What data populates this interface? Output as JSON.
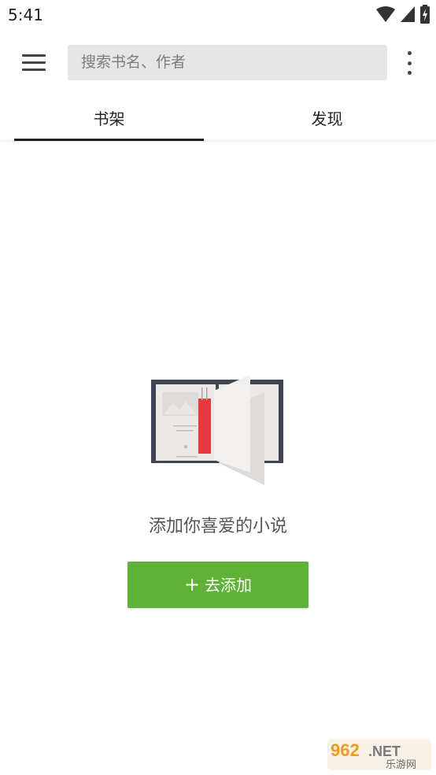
{
  "status_bar": {
    "time": "5:41",
    "icons": [
      "wifi-icon",
      "cellular-signal-icon",
      "battery-charging-icon"
    ]
  },
  "app_bar": {
    "menu_icon": "hamburger-menu-icon",
    "search_placeholder": "搜索书名、作者",
    "more_icon": "more-vert-icon"
  },
  "tabs": [
    {
      "label": "书架",
      "selected": true
    },
    {
      "label": "发现",
      "selected": false
    }
  ],
  "empty_state": {
    "illustration": "open-book-icon",
    "message": "添加你喜爱的小说",
    "button_label": "去添加",
    "button_icon": "plus-icon",
    "button_color": "#5fb236"
  },
  "watermark": {
    "text_top": "962",
    "text_suffix": ".NET",
    "text_bottom": "乐游网"
  }
}
